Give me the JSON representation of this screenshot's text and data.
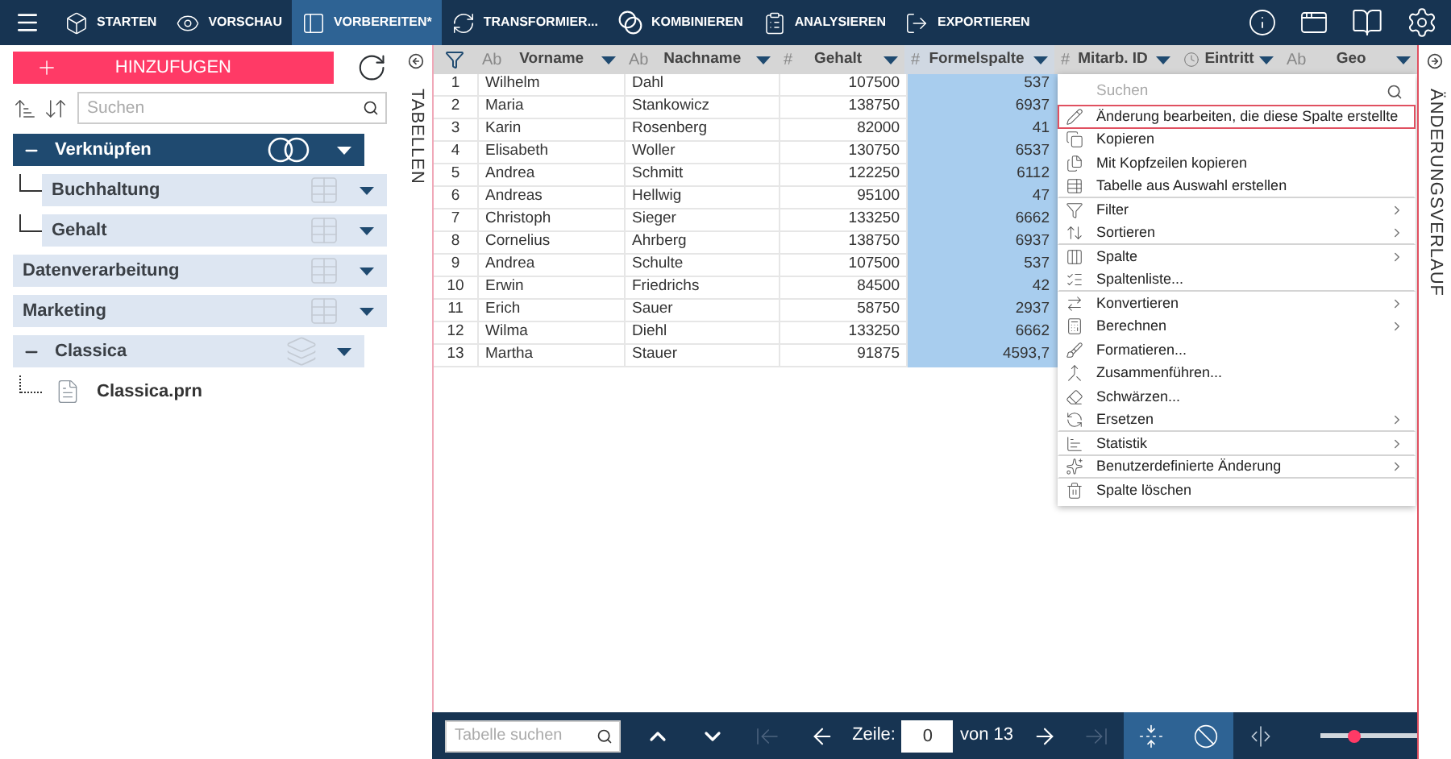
{
  "toolbar": {
    "tabs": [
      {
        "label": "STARTEN",
        "selected": false
      },
      {
        "label": "VORSCHAU",
        "selected": false
      },
      {
        "label": "VORBEREITEN*",
        "selected": true
      },
      {
        "label": "TRANSFORMIER...",
        "selected": false
      },
      {
        "label": "KOMBINIEREN",
        "selected": false
      },
      {
        "label": "ANALYSIEREN",
        "selected": false
      },
      {
        "label": "EXPORTIEREN",
        "selected": false
      }
    ]
  },
  "sidebar": {
    "add_button": "HINZUFUGEN",
    "search_placeholder": "Suchen",
    "tree": [
      {
        "label": "Verknüpfen",
        "kind": "join",
        "selected": true,
        "expanded": true,
        "children": [
          {
            "label": "Buchhaltung",
            "kind": "table",
            "selected": false
          },
          {
            "label": "Gehalt",
            "kind": "table",
            "selected": false
          }
        ]
      },
      {
        "label": "Datenverarbeitung",
        "kind": "table",
        "selected": false
      },
      {
        "label": "Marketing",
        "kind": "table",
        "selected": false
      },
      {
        "label": "Classica",
        "kind": "source",
        "selected": false,
        "expanded": true,
        "children": [
          {
            "label": "Classica.prn",
            "kind": "file",
            "selected": false
          }
        ]
      }
    ]
  },
  "tables_panel": {
    "label": "TABELLEN"
  },
  "grid": {
    "columns": [
      {
        "kind": "text",
        "type": "Ab",
        "name": "Vorname",
        "selected": false
      },
      {
        "kind": "text",
        "type": "Ab",
        "name": "Nachname",
        "selected": false
      },
      {
        "kind": "number",
        "type": "#",
        "name": "Gehalt",
        "selected": false
      },
      {
        "kind": "number",
        "type": "#",
        "name": "Formelspalte",
        "selected": true
      },
      {
        "kind": "number",
        "type": "#",
        "name": "Mitarb. ID",
        "selected": false
      },
      {
        "kind": "date",
        "name": "Eintritt",
        "selected": false
      },
      {
        "kind": "text",
        "type": "Ab",
        "name": "Geo",
        "selected": false
      }
    ],
    "rows": [
      {
        "number": "1",
        "cells": [
          "Wilhelm",
          "Dahl",
          "107500",
          "537"
        ]
      },
      {
        "number": "2",
        "cells": [
          "Maria",
          "Stankowicz",
          "138750",
          "6937"
        ]
      },
      {
        "number": "3",
        "cells": [
          "Karin",
          "Rosenberg",
          "82000",
          "41"
        ]
      },
      {
        "number": "4",
        "cells": [
          "Elisabeth",
          "Woller",
          "130750",
          "6537"
        ]
      },
      {
        "number": "5",
        "cells": [
          "Andrea",
          "Schmitt",
          "122250",
          "6112"
        ]
      },
      {
        "number": "6",
        "cells": [
          "Andreas",
          "Hellwig",
          "95100",
          "47"
        ]
      },
      {
        "number": "7",
        "cells": [
          "Christoph",
          "Sieger",
          "133250",
          "6662"
        ]
      },
      {
        "number": "8",
        "cells": [
          "Cornelius",
          "Ahrberg",
          "138750",
          "6937"
        ]
      },
      {
        "number": "9",
        "cells": [
          "Andrea",
          "Schulte",
          "107500",
          "537"
        ]
      },
      {
        "number": "10",
        "cells": [
          "Erwin",
          "Friedrichs",
          "84500",
          "42"
        ]
      },
      {
        "number": "11",
        "cells": [
          "Erich",
          "Sauer",
          "58750",
          "2937"
        ]
      },
      {
        "number": "12",
        "cells": [
          "Wilma",
          "Diehl",
          "133250",
          "6662"
        ]
      },
      {
        "number": "13",
        "cells": [
          "Martha",
          "Stauer",
          "91875",
          "4593,7"
        ]
      }
    ]
  },
  "context_menu": {
    "search_placeholder": "Suchen",
    "items": [
      {
        "label": "Änderung bearbeiten, die diese Spalte erstellte",
        "selected": true,
        "submenu": false,
        "separator_after": false
      },
      {
        "label": "Kopieren",
        "selected": false,
        "submenu": false,
        "separator_after": false
      },
      {
        "label": "Mit Kopfzeilen kopieren",
        "selected": false,
        "submenu": false,
        "separator_after": false
      },
      {
        "label": "Tabelle aus Auswahl erstellen",
        "selected": false,
        "submenu": false,
        "separator_after": true
      },
      {
        "label": "Filter",
        "selected": false,
        "submenu": true,
        "separator_after": false
      },
      {
        "label": "Sortieren",
        "selected": false,
        "submenu": true,
        "separator_after": true
      },
      {
        "label": "Spalte",
        "selected": false,
        "submenu": true,
        "separator_after": false
      },
      {
        "label": "Spaltenliste...",
        "selected": false,
        "submenu": false,
        "separator_after": true
      },
      {
        "label": "Konvertieren",
        "selected": false,
        "submenu": true,
        "separator_after": false
      },
      {
        "label": "Berechnen",
        "selected": false,
        "submenu": true,
        "separator_after": false
      },
      {
        "label": "Formatieren...",
        "selected": false,
        "submenu": false,
        "separator_after": false
      },
      {
        "label": "Zusammenführen...",
        "selected": false,
        "submenu": false,
        "separator_after": false
      },
      {
        "label": "Schwärzen...",
        "selected": false,
        "submenu": false,
        "separator_after": false
      },
      {
        "label": "Ersetzen",
        "selected": false,
        "submenu": true,
        "separator_after": true
      },
      {
        "label": "Statistik",
        "selected": false,
        "submenu": true,
        "separator_after": true
      },
      {
        "label": "Benutzerdefinierte Änderung",
        "selected": false,
        "submenu": true,
        "separator_after": true
      },
      {
        "label": "Spalte löschen",
        "selected": false,
        "submenu": false,
        "separator_after": false
      }
    ]
  },
  "history_panel": {
    "label": "ÄNDERUNGSVERLAUF"
  },
  "footer": {
    "search_placeholder": "Tabelle suchen",
    "nav_before": [
      {
        "kind": "up",
        "disabled": false
      },
      {
        "kind": "down",
        "disabled": false
      },
      {
        "kind": "first",
        "disabled": true
      },
      {
        "kind": "prev",
        "disabled": false
      }
    ],
    "row_label": "Zeile:",
    "row_value": "0",
    "row_total": "von 13",
    "nav_after": [
      {
        "kind": "next",
        "disabled": false
      },
      {
        "kind": "last",
        "disabled": true
      }
    ],
    "toggles": [
      {
        "kind": "fit",
        "on": true
      },
      {
        "kind": "null",
        "on": true
      },
      {
        "kind": "split",
        "on": false
      }
    ],
    "zoom": {
      "level": 0.35
    }
  }
}
